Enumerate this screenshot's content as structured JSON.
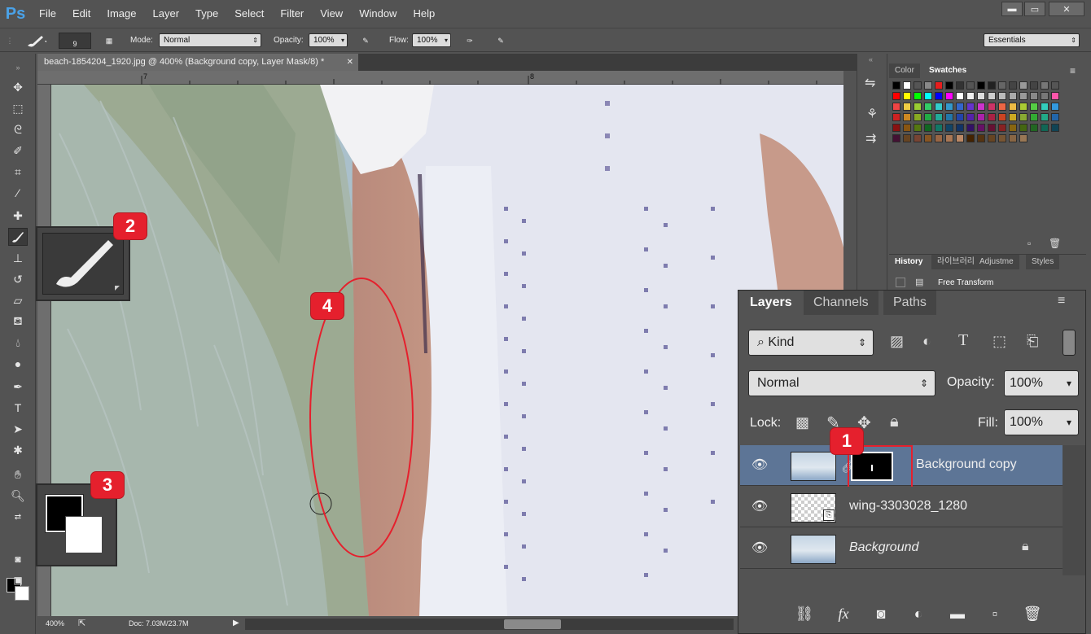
{
  "app": {
    "logo": "Ps"
  },
  "menu": [
    "File",
    "Edit",
    "Image",
    "Layer",
    "Type",
    "Select",
    "Filter",
    "View",
    "Window",
    "Help"
  ],
  "window_controls": {
    "minimize": "▬",
    "maximize": "▭",
    "close": "✕"
  },
  "options": {
    "brush_size": "9",
    "mode_label": "Mode:",
    "mode_value": "Normal",
    "opacity_label": "Opacity:",
    "opacity_value": "100%",
    "flow_label": "Flow:",
    "flow_value": "100%",
    "workspace": "Essentials"
  },
  "document": {
    "tab_title": "beach-1854204_1920.jpg @ 400% (Background copy, Layer Mask/8) *",
    "ruler_marks": [
      "7",
      "8"
    ],
    "zoom": "400%",
    "doc_size": "Doc: 7.03M/23.7M"
  },
  "tools": [
    "move-tool",
    "marquee-tool",
    "lasso-tool",
    "quick-select-tool",
    "crop-tool",
    "eyedropper-tool",
    "healing-tool",
    "brush-tool",
    "clone-stamp-tool",
    "history-brush-tool",
    "eraser-tool",
    "paint-bucket-tool",
    "blur-tool",
    "dodge-tool",
    "pen-tool",
    "type-tool",
    "path-select-tool",
    "shape-tool",
    "hand-tool",
    "zoom-tool"
  ],
  "colors": {
    "foreground": "#000000",
    "background": "#ffffff",
    "accent": "#e5202d",
    "selection": "#5d7596"
  },
  "swatch_panel": {
    "tabs": [
      "Color",
      "Swatches"
    ],
    "active_tab": "Swatches"
  },
  "history_panel": {
    "tabs": [
      "History",
      "라이브러리",
      "Adjustme",
      "Styles"
    ],
    "item": "Free Transform"
  },
  "layers_panel": {
    "tabs": [
      "Layers",
      "Channels",
      "Paths"
    ],
    "kind_filter": "Kind",
    "blend_mode": "Normal",
    "opacity_label": "Opacity:",
    "opacity_value": "100%",
    "lock_label": "Lock:",
    "fill_label": "Fill:",
    "fill_value": "100%",
    "layers": [
      {
        "name": "Background copy",
        "selected": true,
        "has_mask": true
      },
      {
        "name": "wing-3303028_1280",
        "selected": false,
        "smart_object": true
      },
      {
        "name": "Background",
        "selected": false,
        "locked": true,
        "italic": true
      }
    ]
  },
  "annotations": [
    "1",
    "2",
    "3",
    "4"
  ]
}
